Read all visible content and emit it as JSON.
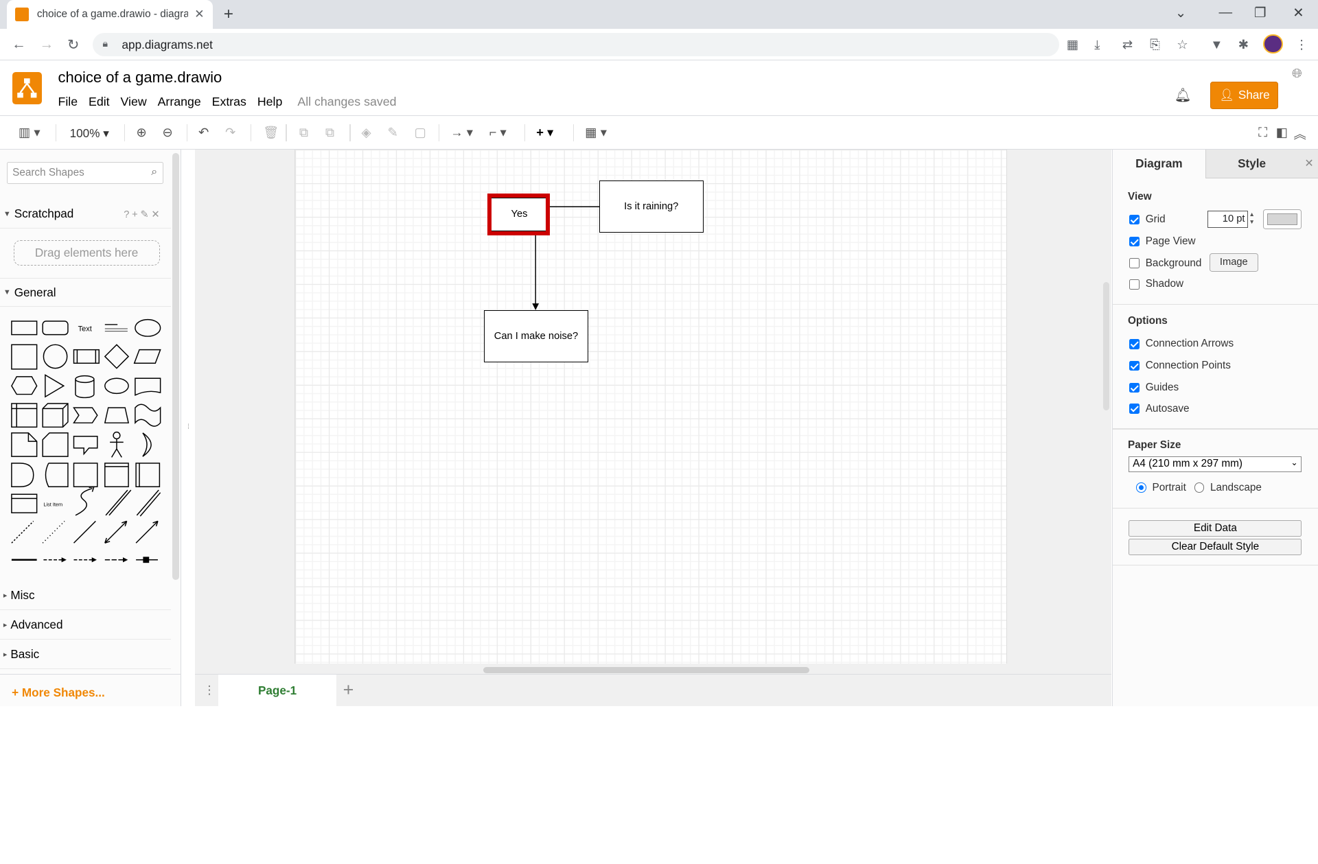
{
  "browser": {
    "tab_title": "choice of a game.drawio - diagrams.net",
    "url": "app.diagrams.net"
  },
  "app": {
    "doc_title": "choice of a game.drawio",
    "menu": [
      "File",
      "Edit",
      "View",
      "Arrange",
      "Extras",
      "Help"
    ],
    "status": "All changes saved",
    "share_label": "Share"
  },
  "toolbar": {
    "zoom": "100%"
  },
  "left_panel": {
    "search_placeholder": "Search Shapes",
    "scratchpad_label": "Scratchpad",
    "drag_hint": "Drag elements here",
    "general_label": "General",
    "sections": [
      "Misc",
      "Advanced",
      "Basic"
    ],
    "more_shapes": "More Shapes...",
    "shape_text_label": "Text",
    "shape_list_item_label": "List Item"
  },
  "diagram": {
    "nodes": [
      {
        "id": "yes",
        "label": "Yes"
      },
      {
        "id": "raining",
        "label": "Is it raining?"
      },
      {
        "id": "noise",
        "label": "Can I make noise?"
      }
    ]
  },
  "pages": {
    "current": "Page-1"
  },
  "right_panel": {
    "tabs": [
      "Diagram",
      "Style"
    ],
    "view_label": "View",
    "grid_label": "Grid",
    "grid_size": "10 pt",
    "page_view_label": "Page View",
    "background_label": "Background",
    "image_button": "Image",
    "shadow_label": "Shadow",
    "options_label": "Options",
    "connection_arrows": "Connection Arrows",
    "connection_points": "Connection Points",
    "guides": "Guides",
    "autosave": "Autosave",
    "paper_size_label": "Paper Size",
    "paper_size_value": "A4 (210 mm x 297 mm)",
    "portrait": "Portrait",
    "landscape": "Landscape",
    "edit_data": "Edit Data",
    "clear_style": "Clear Default Style"
  },
  "colors": {
    "accent": "#f08705",
    "highlight": "#cc0000",
    "page_tab_text": "#2e7d32"
  }
}
